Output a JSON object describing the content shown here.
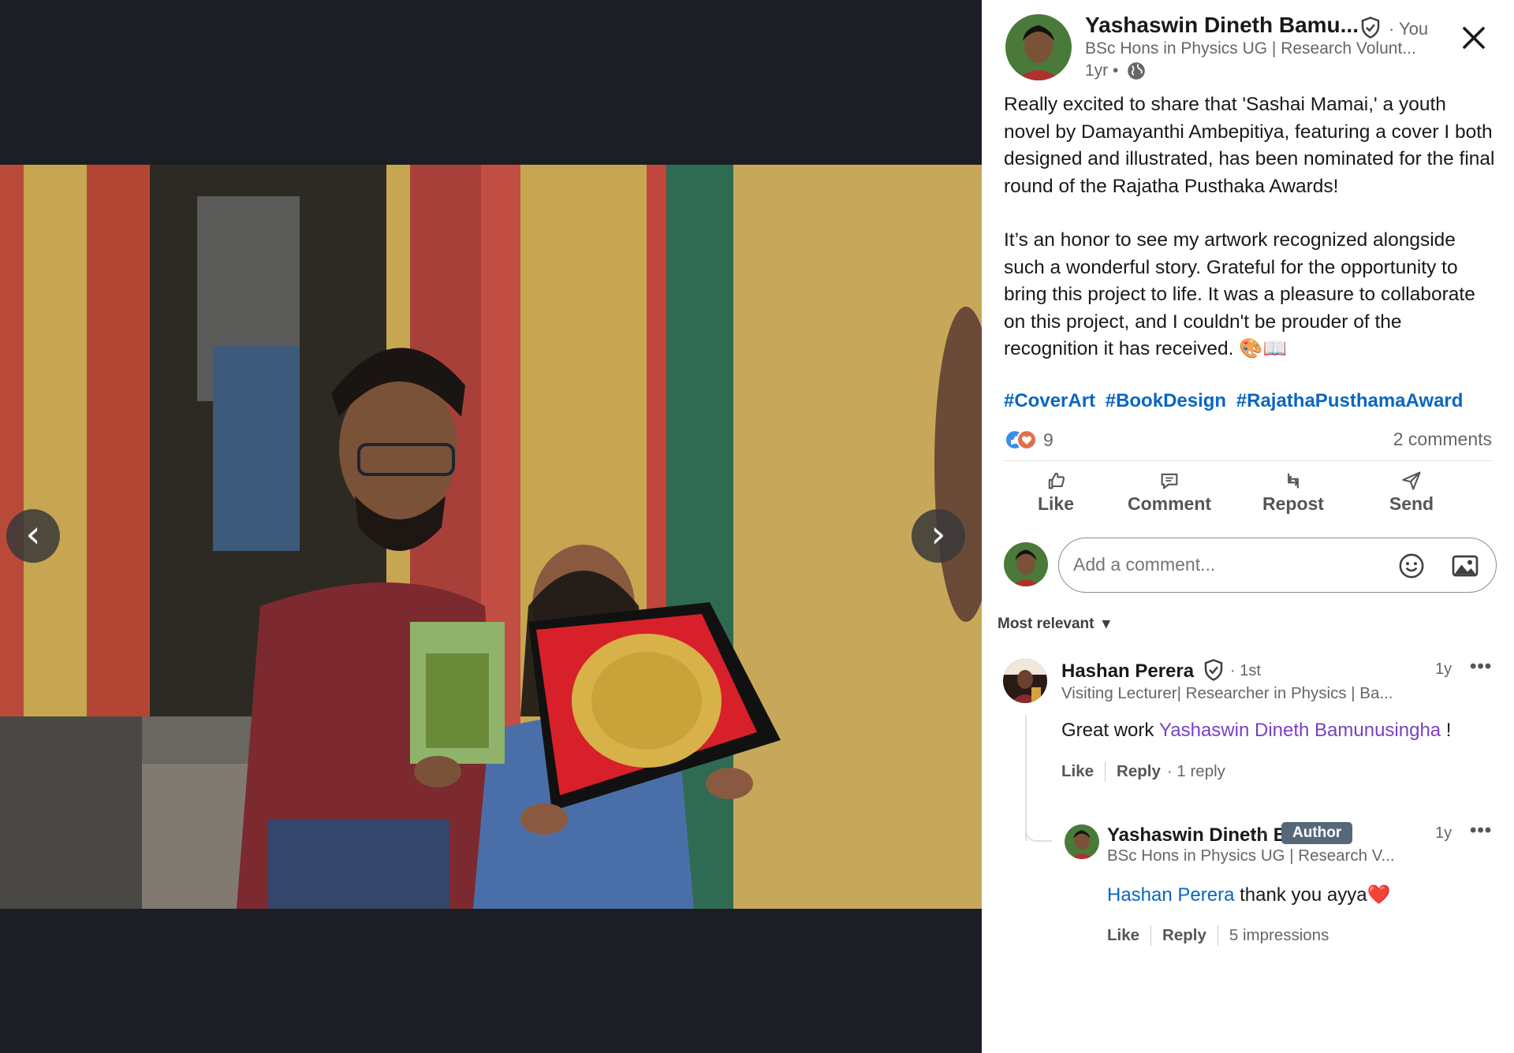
{
  "post": {
    "author_name": "Yashaswin Dineth Bamu...",
    "connection": "· You",
    "headline": "BSc Hons in Physics UG | Research Volunt...",
    "time": "1yr •",
    "paragraph1": "Really excited to share that 'Sashai Mamai,' a youth novel by Damayanthi Ambepitiya, featuring a cover I both designed and illustrated, has been nominated for the final round of the Rajatha Pusthaka Awards!",
    "paragraph2": "It’s an honor to see my artwork recognized alongside such a wonderful story. Grateful for the opportunity to bring this project to life. It was a pleasure to collaborate on this project, and I couldn't be prouder of the recognition it has received. 🎨📖",
    "hashtags": [
      "#CoverArt",
      "#BookDesign",
      "#RajathaPusthamaAward"
    ],
    "reaction_count": "9",
    "comments_count": "2 comments"
  },
  "actions": {
    "like": "Like",
    "comment": "Comment",
    "repost": "Repost",
    "send": "Send"
  },
  "comment_input": {
    "placeholder": "Add a comment..."
  },
  "sort_label": "Most relevant",
  "comments": [
    {
      "name": "Hashan Perera",
      "degree": "· 1st",
      "headline": "Visiting Lecturer| Researcher in Physics | Ba...",
      "time": "1y",
      "text_prefix": "Great work ",
      "mention": "Yashaswin Dineth Bamunusingha",
      "text_suffix": " !",
      "like": "Like",
      "reply": "Reply",
      "replies": "· 1 reply"
    },
    {
      "name": "Yashaswin Dineth B...",
      "ellipsis": "···",
      "badge": "Author",
      "headline": "BSc Hons in Physics UG | Research V...",
      "time": "1y",
      "mention": "Hashan Perera",
      "text_suffix": " thank you ayya❤️",
      "like": "Like",
      "reply": "Reply",
      "impressions": "5 impressions"
    }
  ],
  "icons": {
    "prev": "chevron-left-icon",
    "next": "chevron-right-icon",
    "close": "close-icon",
    "verified": "verified-shield-icon",
    "globe": "globe-icon",
    "emoji": "emoji-icon",
    "image": "image-icon",
    "more": "more-icon"
  },
  "colors": {
    "link": "#0a66c2",
    "mention": "#7b3fc6",
    "author_badge": "#56687a",
    "dark_background": "#1b1f23"
  }
}
